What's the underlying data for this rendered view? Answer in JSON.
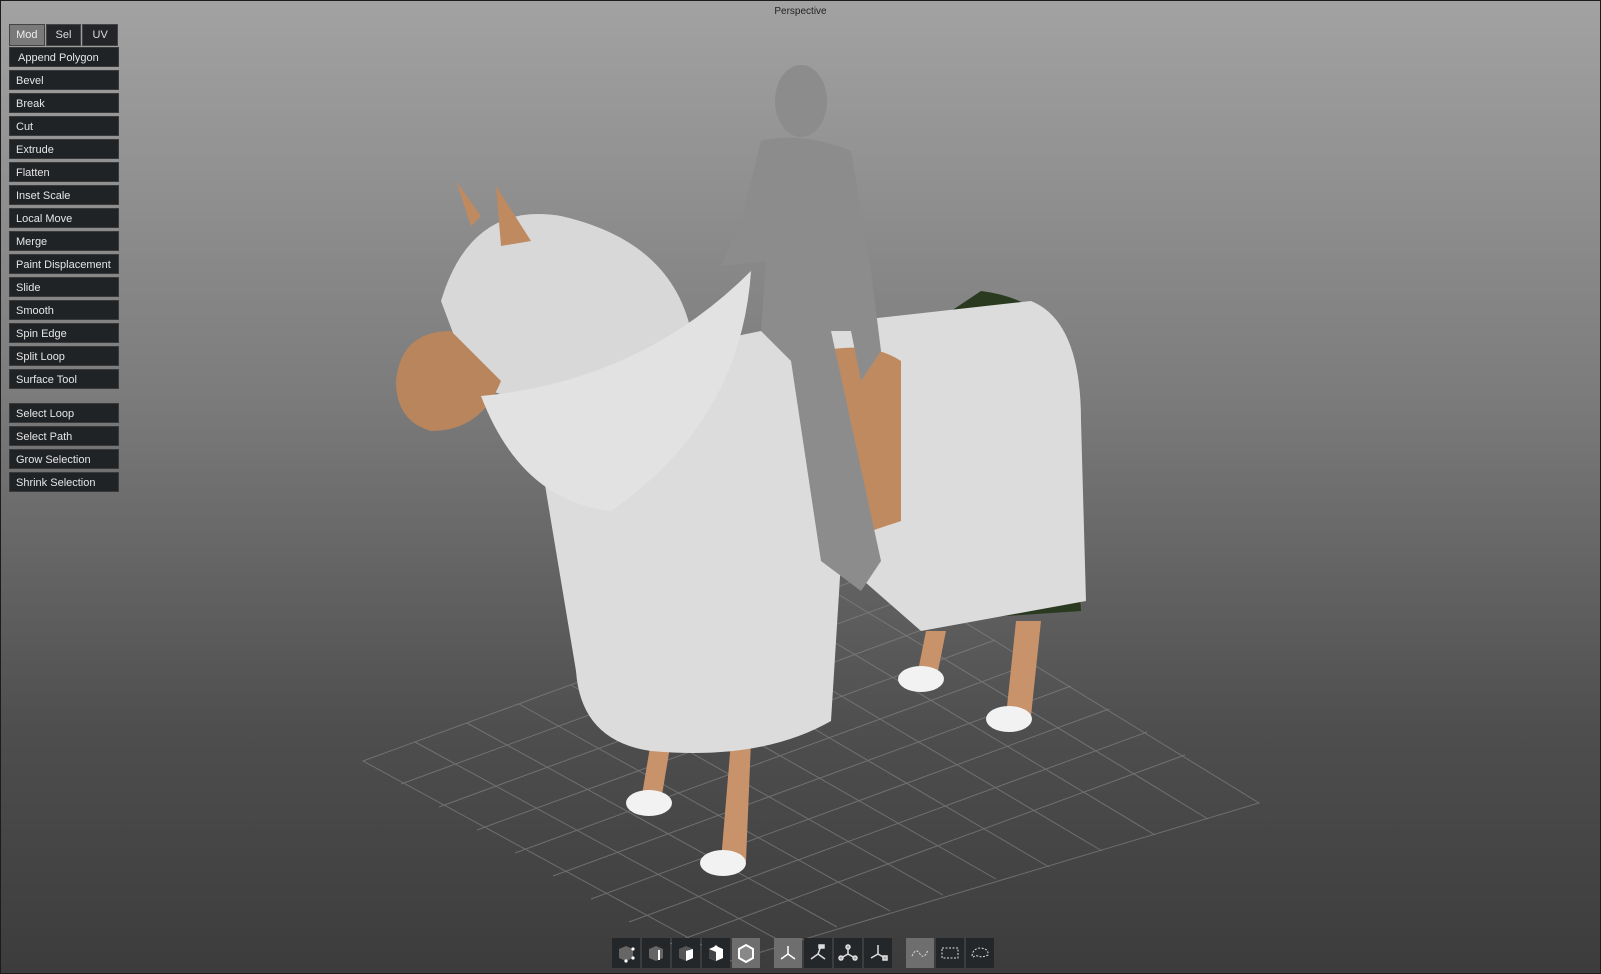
{
  "viewport": {
    "title": "Perspective"
  },
  "tabs": [
    {
      "label": "Mod",
      "active": true
    },
    {
      "label": "Sel",
      "active": false
    },
    {
      "label": "UV",
      "active": false
    }
  ],
  "modeling_tools": [
    "Append Polygon",
    "Bevel",
    "Break",
    "Cut",
    "Extrude",
    "Flatten",
    "Inset Scale",
    "Local Move",
    "Merge",
    "Paint Displacement",
    "Slide",
    "Smooth",
    "Spin Edge",
    "Split Loop",
    "Surface Tool"
  ],
  "selection_tools": [
    "Select Loop",
    "Select Path",
    "Grow Selection",
    "Shrink Selection"
  ],
  "toolbar": {
    "component_modes": [
      {
        "icon": "vertex-mode-icon"
      },
      {
        "icon": "edge-mode-icon"
      },
      {
        "icon": "face-mode-icon"
      },
      {
        "icon": "uv-mode-icon"
      },
      {
        "icon": "object-mode-icon",
        "active": true
      }
    ],
    "transform_tools": [
      {
        "icon": "select-tool-icon",
        "active": true
      },
      {
        "icon": "move-tool-icon"
      },
      {
        "icon": "rotate-tool-icon"
      },
      {
        "icon": "scale-tool-icon"
      }
    ],
    "selection_shapes": [
      {
        "icon": "paint-select-icon",
        "active": true
      },
      {
        "icon": "rect-select-icon"
      },
      {
        "icon": "lasso-select-icon"
      }
    ]
  }
}
